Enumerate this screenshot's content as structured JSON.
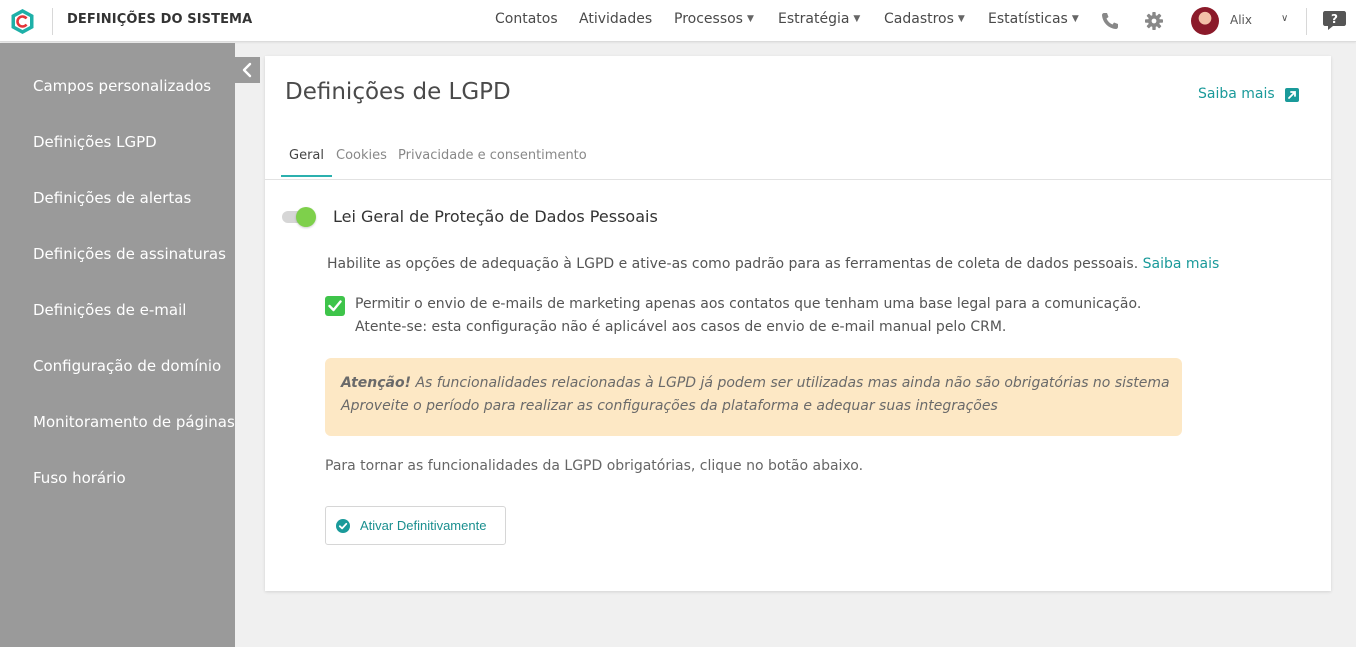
{
  "header": {
    "app_title": "DEFINIÇÕES DO SISTEMA",
    "nav": [
      {
        "label": "Contatos",
        "has_dropdown": false
      },
      {
        "label": "Atividades",
        "has_dropdown": false
      },
      {
        "label": "Processos",
        "has_dropdown": true
      },
      {
        "label": "Estratégia",
        "has_dropdown": true
      },
      {
        "label": "Cadastros",
        "has_dropdown": true
      },
      {
        "label": "Estatísticas",
        "has_dropdown": true
      }
    ],
    "user_name": "Alix",
    "icons": [
      "phone-icon",
      "gear-icon",
      "avatar",
      "chevron-down-icon",
      "help-chat-icon"
    ]
  },
  "sidebar": {
    "items": [
      {
        "label": "Campos personalizados"
      },
      {
        "label": "Definições LGPD"
      },
      {
        "label": "Definições de alertas"
      },
      {
        "label": "Definições de assinaturas"
      },
      {
        "label": "Definições de e-mail"
      },
      {
        "label": "Configuração de domínio"
      },
      {
        "label": "Monitoramento de páginas"
      },
      {
        "label": "Fuso horário"
      }
    ]
  },
  "main": {
    "title": "Definições de LGPD",
    "learn_more": "Saiba mais",
    "tabs": [
      {
        "label": "Geral",
        "active": true
      },
      {
        "label": "Cookies",
        "active": false
      },
      {
        "label": "Privacidade e consentimento",
        "active": false
      }
    ],
    "section": {
      "toggle_on": true,
      "title": "Lei Geral de Proteção de Dados Pessoais",
      "description": "Habilite as opções de adequação à LGPD e ative-as como padrão para as ferramentas de coleta de dados pessoais.",
      "description_link": "Saiba mais",
      "checkbox_checked": true,
      "checkbox_line1": "Permitir o envio de e-mails de marketing apenas aos contatos que tenham uma base legal para a comunicação.",
      "checkbox_line2": "Atente-se: esta configuração não é aplicável aos casos de envio de e-mail manual pelo CRM.",
      "alert_strong": "Atenção!",
      "alert_line1": "As funcionalidades relacionadas à LGPD já podem ser utilizadas mas ainda não são obrigatórias no sistema",
      "alert_line2": "Aproveite o período para realizar as configurações da plataforma e adequar suas integrações",
      "info": "Para tornar as funcionalidades da LGPD obrigatórias, clique no botão abaixo.",
      "activate_button": "Ativar Definitivamente"
    }
  },
  "colors": {
    "accent": "#1a9a9a",
    "toggle_knob": "#7ed04b",
    "checkbox": "#3ec44a",
    "alert_bg": "#fde8c5",
    "sidebar_bg": "#9a9a9a",
    "logo": "#1eb0a8"
  }
}
